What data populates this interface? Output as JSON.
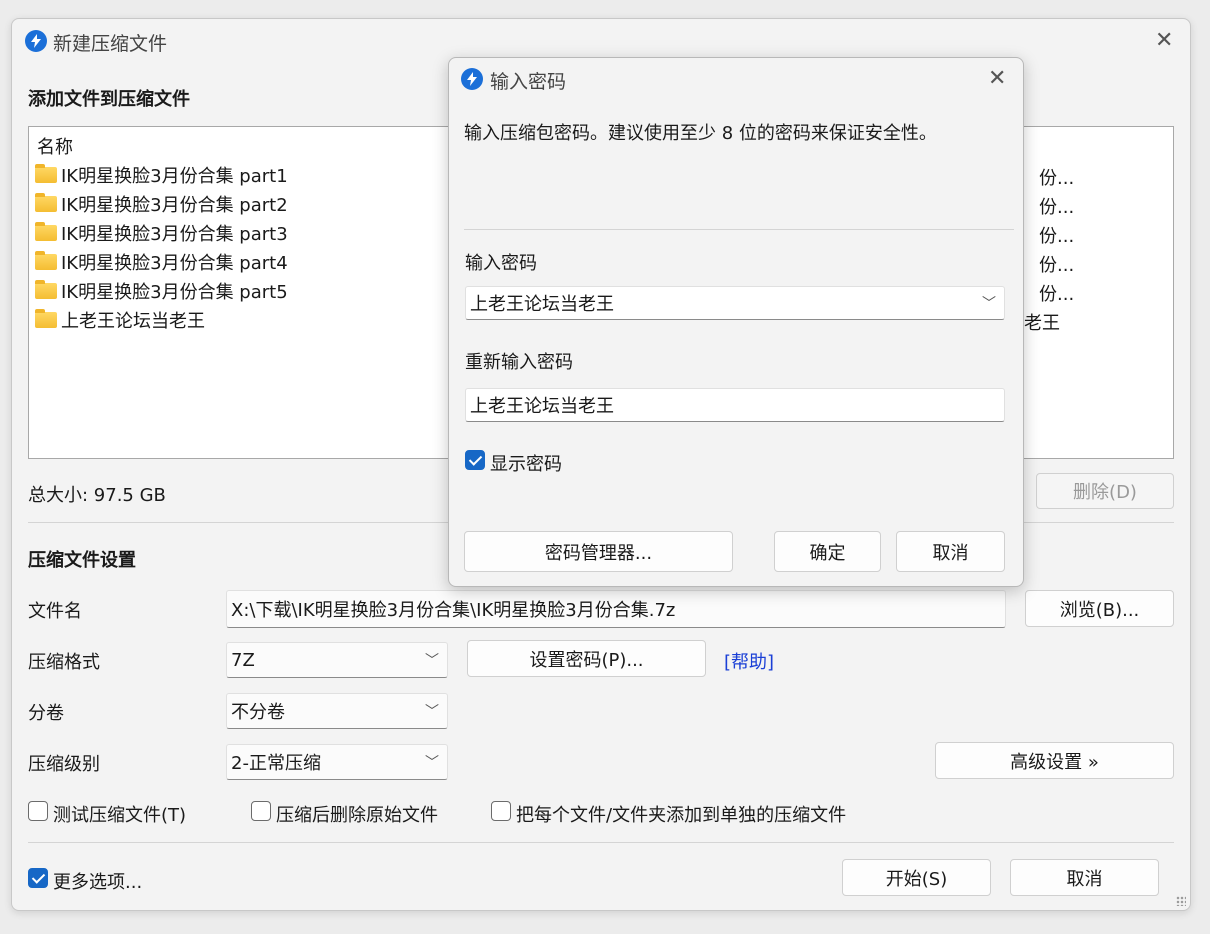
{
  "main": {
    "title": "新建压缩文件",
    "add_heading": "添加文件到压缩文件",
    "list": {
      "column_name": "名称",
      "items": [
        {
          "name": "IK明星换脸3月份合集 part1",
          "clipped": "份..."
        },
        {
          "name": "IK明星换脸3月份合集 part2",
          "clipped": "份..."
        },
        {
          "name": "IK明星换脸3月份合集 part3",
          "clipped": "份..."
        },
        {
          "name": "IK明星换脸3月份合集 part4",
          "clipped": "份..."
        },
        {
          "name": "IK明星换脸3月份合集 part5",
          "clipped": "份..."
        },
        {
          "name": "上老王论坛当老王",
          "clipped": "老王"
        }
      ]
    },
    "total_size": "总大小: 97.5 GB",
    "delete_label": "删除(D)",
    "settings_heading": "压缩文件设置",
    "filename_label": "文件名",
    "filename_value": "X:\\下载\\IK明星换脸3月份合集\\IK明星换脸3月份合集.7z",
    "browse_label": "浏览(B)...",
    "format_label": "压缩格式",
    "format_value": "7Z",
    "set_password_label": "设置密码(P)...",
    "help_label": "[帮助]",
    "volume_label": "分卷",
    "volume_value": "不分卷",
    "level_label": "压缩级别",
    "level_value": "2-正常压缩",
    "advanced_label": "高级设置 »",
    "test_label": "测试压缩文件(T)",
    "delete_after_label": "压缩后删除原始文件",
    "separate_label": "把每个文件/文件夹添加到单独的压缩文件",
    "more_options_label": "更多选项...",
    "start_label": "开始(S)",
    "cancel_label": "取消"
  },
  "dialog": {
    "title": "输入密码",
    "description": "输入压缩包密码。建议使用至少 8 位的密码来保证安全性。",
    "password_label": "输入密码",
    "password_value": "上老王论坛当老王",
    "reenter_label": "重新输入密码",
    "reenter_value": "上老王论坛当老王",
    "show_password_label": "显示密码",
    "manager_label": "密码管理器...",
    "ok_label": "确定",
    "cancel_label": "取消"
  },
  "colors": {
    "accent": "#1667c6",
    "link": "#1a3fd6",
    "folder": "#f4bd32"
  },
  "icons": {
    "app": "bandizip-icon",
    "close": "close-icon",
    "folder": "folder-icon",
    "dropdown": "chevron-down-icon",
    "check": "checkmark-icon"
  }
}
